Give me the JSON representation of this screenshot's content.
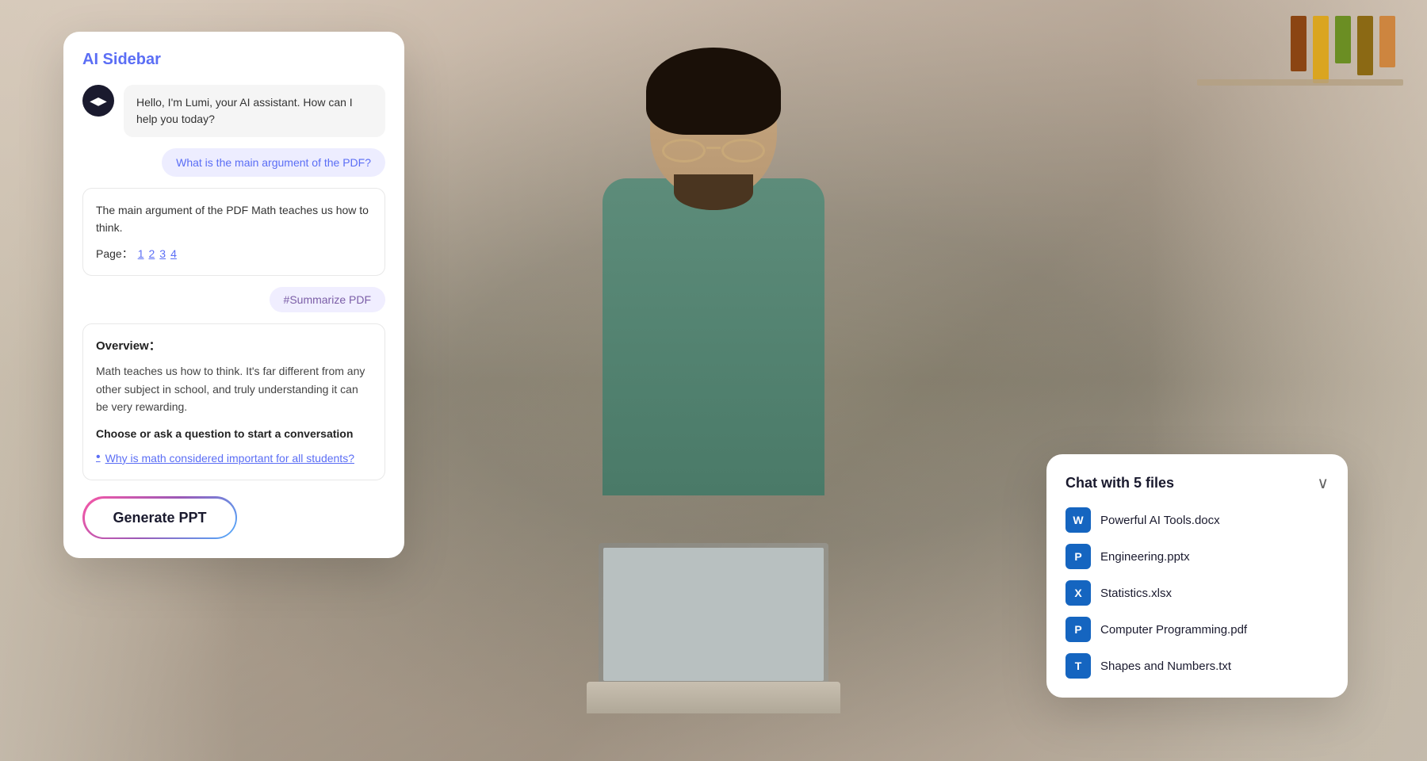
{
  "background": {
    "color_start": "#e8ddd0",
    "color_end": "#c8b8a8"
  },
  "ai_sidebar": {
    "title": "AI Sidebar",
    "avatar_emoji": "◀▶",
    "ai_greeting": "Hello, I'm Lumi, your AI assistant. How can I help you today?",
    "user_question": "What is the main argument of the PDF?",
    "ai_response_text": "The main argument of the PDF Math teaches us how to think.",
    "page_label": "Page：",
    "page_links": [
      "1",
      "2",
      "3",
      "4"
    ],
    "summarize_label": "#Summarize PDF",
    "overview_title": "Overview：",
    "overview_desc": "Math teaches us how to think. It's far different from any other subject in school, and truly understanding it can be very rewarding.",
    "choose_label": "Choose or ask a question to start a conversation",
    "question_link": "Why is math considered important for all students?",
    "generate_ppt_label": "Generate PPT"
  },
  "chat_files": {
    "title": "Chat with 5 files",
    "chevron": "∨",
    "files": [
      {
        "name": "Powerful AI Tools.docx",
        "icon": "W",
        "color": "#1565c0"
      },
      {
        "name": "Engineering.pptx",
        "icon": "P",
        "color": "#1565c0"
      },
      {
        "name": "Statistics.xlsx",
        "icon": "X",
        "color": "#1565c0"
      },
      {
        "name": "Computer Programming.pdf",
        "icon": "P",
        "color": "#1565c0"
      },
      {
        "name": "Shapes and Numbers.txt",
        "icon": "T",
        "color": "#1565c0"
      }
    ]
  }
}
